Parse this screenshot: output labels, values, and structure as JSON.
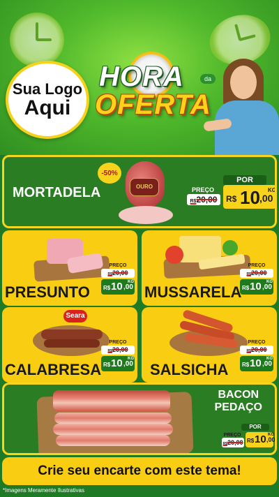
{
  "header": {
    "logo_line1": "Sua Logo",
    "logo_line2": "Aqui",
    "title_top": "HORA",
    "title_da": "da",
    "title_bottom": "OFERTA"
  },
  "featured": {
    "name": "MORTADELA",
    "discount": "-50%",
    "brand_label": "OURO",
    "price": {
      "por": "POR",
      "preco": "PREÇO",
      "old_currency": "R$",
      "old": "20,00",
      "currency": "R$",
      "whole": "10",
      "cents": ",00",
      "unit": "KG"
    }
  },
  "products": [
    {
      "name": "PRESUNTO",
      "price": {
        "preco": "PREÇO",
        "old_currency": "R$",
        "old": "20,00",
        "currency": "R$",
        "whole": "10",
        "cents": ",00",
        "unit": "KG"
      }
    },
    {
      "name": "MUSSARELA",
      "price": {
        "preco": "PREÇO",
        "old_currency": "R$",
        "old": "20,00",
        "currency": "R$",
        "whole": "10",
        "cents": ",00",
        "unit": "KG"
      }
    },
    {
      "name": "CALABRESA",
      "brand": "Seara",
      "price": {
        "preco": "PREÇO",
        "old_currency": "R$",
        "old": "20,00",
        "currency": "R$",
        "whole": "10",
        "cents": ",00",
        "unit": "KG"
      }
    },
    {
      "name": "SALSICHA",
      "price": {
        "preco": "PREÇO",
        "old_currency": "R$",
        "old": "20,00",
        "currency": "R$",
        "whole": "10",
        "cents": ",00",
        "unit": "KG"
      }
    }
  ],
  "bacon": {
    "line1": "BACON",
    "line2": "PEDAÇO",
    "price": {
      "por": "POR",
      "preco": "PREÇO",
      "old_currency": "R$",
      "old": "20,00",
      "currency": "R$",
      "whole": "10",
      "cents": ",00",
      "unit": "KG"
    }
  },
  "cta": "Crie seu encarte com este tema!",
  "disclaimer": "*Imagens Meramente Ilustrativas",
  "colors": {
    "primary_green": "#2a7d22",
    "accent_yellow": "#f8cd12",
    "price_dark_green": "#1b5e18"
  }
}
